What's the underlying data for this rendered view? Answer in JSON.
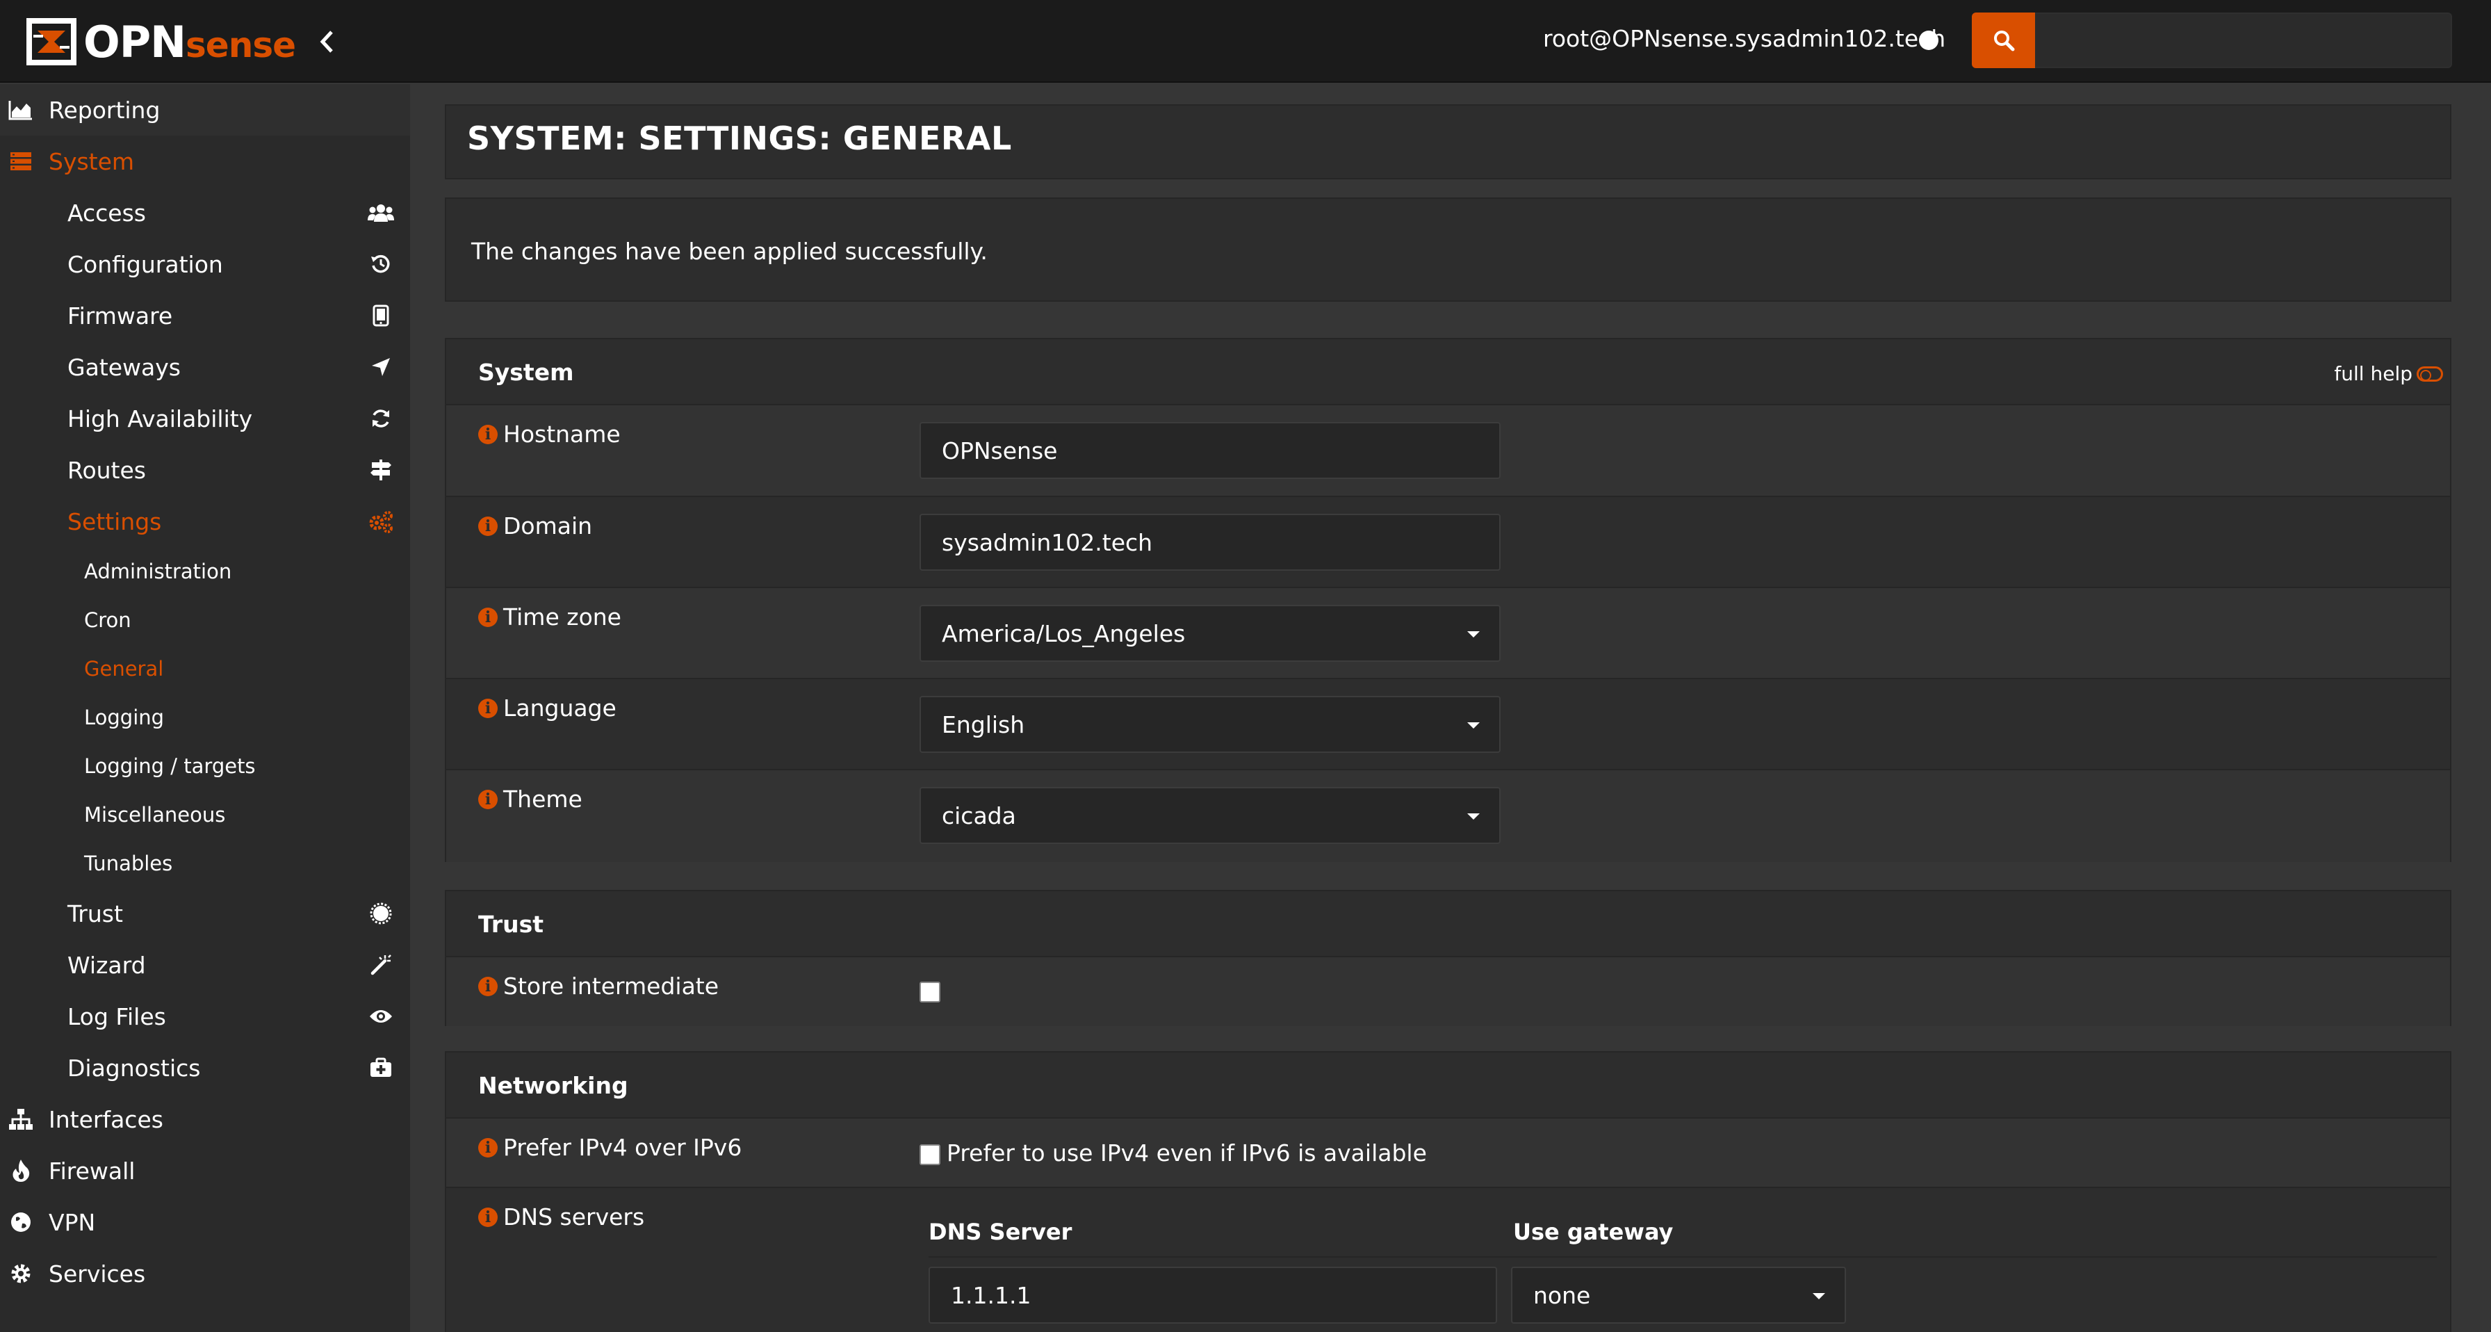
{
  "header": {
    "logo_text": "OPN",
    "logo_sense": "sense",
    "user": "root@OPNsense.sysadmin102.tech",
    "search_placeholder": ""
  },
  "sidebar": {
    "top_items": [
      {
        "label": "Reporting",
        "icon": "chart-area-icon"
      },
      {
        "label": "System",
        "icon": "server-icon"
      },
      {
        "label": "Interfaces",
        "icon": "sitemap-icon"
      },
      {
        "label": "Firewall",
        "icon": "fire-icon"
      },
      {
        "label": "VPN",
        "icon": "globe-icon"
      },
      {
        "label": "Services",
        "icon": "cog-icon"
      }
    ],
    "system_items": [
      {
        "label": "Access",
        "icon": "users-icon"
      },
      {
        "label": "Configuration",
        "icon": "history-icon"
      },
      {
        "label": "Firmware",
        "icon": "tablet-icon"
      },
      {
        "label": "Gateways",
        "icon": "location-arrow-icon"
      },
      {
        "label": "High Availability",
        "icon": "refresh-icon"
      },
      {
        "label": "Routes",
        "icon": "map-signs-icon"
      },
      {
        "label": "Settings",
        "icon": "cogs-icon"
      },
      {
        "label": "Trust",
        "icon": "certificate-icon"
      },
      {
        "label": "Wizard",
        "icon": "magic-wand-icon"
      },
      {
        "label": "Log Files",
        "icon": "eye-icon"
      },
      {
        "label": "Diagnostics",
        "icon": "medkit-icon"
      }
    ],
    "settings_items": [
      {
        "label": "Administration"
      },
      {
        "label": "Cron"
      },
      {
        "label": "General"
      },
      {
        "label": "Logging"
      },
      {
        "label": "Logging / targets"
      },
      {
        "label": "Miscellaneous"
      },
      {
        "label": "Tunables"
      }
    ],
    "active": "General"
  },
  "main": {
    "page_title": "SYSTEM: SETTINGS: GENERAL",
    "success_message": "The changes have been applied successfully.",
    "full_help_label": "full help",
    "system_section": {
      "title": "System",
      "fields": [
        {
          "label": "Hostname",
          "value": "OPNsense",
          "type": "text"
        },
        {
          "label": "Domain",
          "value": "sysadmin102.tech",
          "type": "text"
        },
        {
          "label": "Time zone",
          "value": "America/Los_Angeles",
          "type": "select"
        },
        {
          "label": "Language",
          "value": "English",
          "type": "select"
        },
        {
          "label": "Theme",
          "value": "cicada",
          "type": "select"
        }
      ]
    },
    "trust_section": {
      "title": "Trust",
      "store_intermediate_label": "Store intermediate",
      "store_intermediate_checked": false
    },
    "networking_section": {
      "title": "Networking",
      "prefer_ipv4_label": "Prefer IPv4 over IPv6",
      "prefer_ipv4_checkbox_text": "Prefer to use IPv4 even if IPv6 is available",
      "prefer_ipv4_checked": false,
      "dns_label": "DNS servers",
      "dns_col_server": "DNS Server",
      "dns_col_gateway": "Use gateway",
      "dns_rows": [
        {
          "server": "1.1.1.1",
          "gateway": "none"
        }
      ]
    }
  },
  "colors": {
    "accent": "#d94f00",
    "sidebar_bg": "#2a2a2a",
    "topbar_bg": "#1b1b1b",
    "panel_bg": "#2d2d2d"
  }
}
